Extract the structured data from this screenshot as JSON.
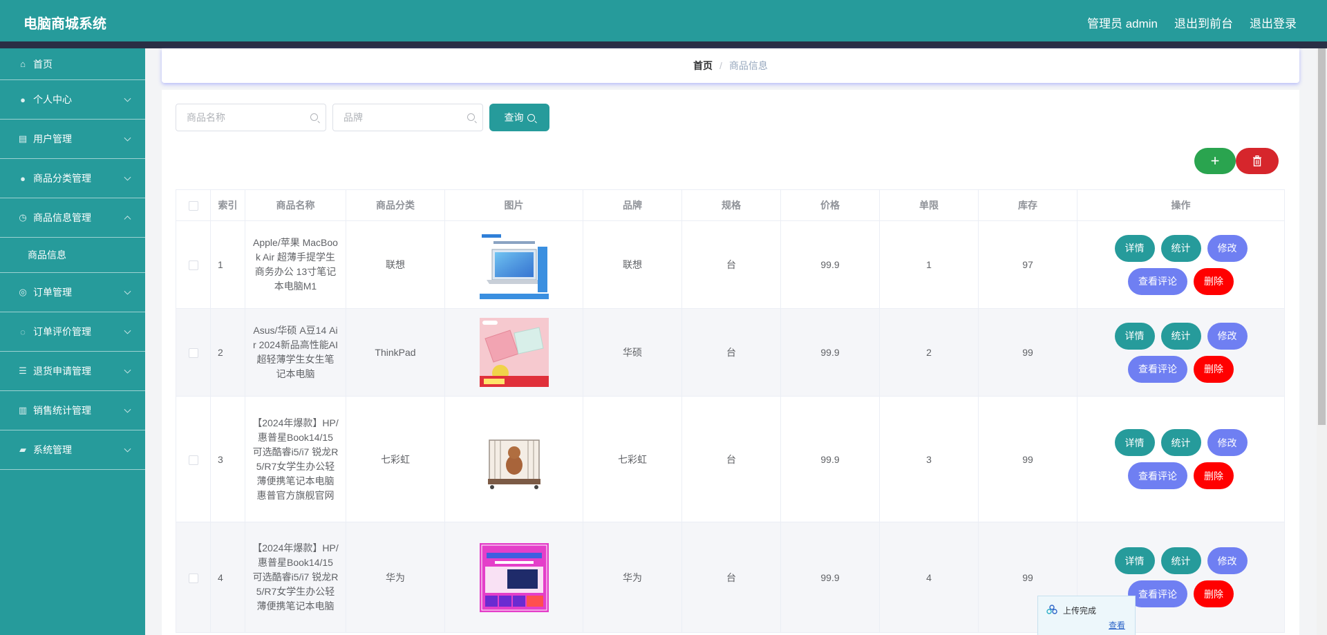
{
  "header": {
    "title": "电脑商城系统",
    "admin_label": "管理员 admin",
    "front_link": "退出到前台",
    "logout_link": "退出登录"
  },
  "sidebar": {
    "items": [
      {
        "label": "首页",
        "icon": "home-icon",
        "expandable": false
      },
      {
        "label": "个人中心",
        "icon": "user-icon",
        "expandable": true
      },
      {
        "label": "用户管理",
        "icon": "users-icon",
        "expandable": true
      },
      {
        "label": "商品分类管理",
        "icon": "user-icon",
        "expandable": true
      },
      {
        "label": "商品信息管理",
        "icon": "clock-icon",
        "expandable": true,
        "expanded": true,
        "children": [
          "商品信息"
        ]
      },
      {
        "label": "订单管理",
        "icon": "globe-icon",
        "expandable": true
      },
      {
        "label": "订单评价管理",
        "icon": "compass-icon",
        "expandable": true
      },
      {
        "label": "退货申请管理",
        "icon": "list-icon",
        "expandable": true
      },
      {
        "label": "销售统计管理",
        "icon": "bar-chart-icon",
        "expandable": true
      },
      {
        "label": "系统管理",
        "icon": "settings-icon",
        "expandable": true
      }
    ]
  },
  "breadcrumb": {
    "home": "首页",
    "separator": "/",
    "current": "商品信息"
  },
  "search": {
    "name_placeholder": "商品名称",
    "brand_placeholder": "品牌",
    "query_label": "查询"
  },
  "actions": {
    "add_symbol": "+",
    "add_color": "#2aa44f",
    "delete_color": "#d6262c"
  },
  "table": {
    "headers": [
      "索引",
      "商品名称",
      "商品分类",
      "图片",
      "品牌",
      "规格",
      "价格",
      "单限",
      "库存",
      "操作"
    ],
    "rows": [
      {
        "index": "1",
        "name": "Apple/苹果 MacBook Air 超薄手提学生商务办公 13寸笔记本电脑M1",
        "category": "联想",
        "image": "laptop-silver-thumbnail",
        "brand": "联想",
        "spec": "台",
        "price": "99.9",
        "limit": "1",
        "stock": "97"
      },
      {
        "index": "2",
        "name": "Asus/华硕 A豆14 Air 2024新品高性能AI超轻薄学生女生笔记本电脑",
        "category": "ThinkPad",
        "image": "laptop-pink-thumbnail",
        "brand": "华硕",
        "spec": "台",
        "price": "99.9",
        "limit": "2",
        "stock": "99"
      },
      {
        "index": "3",
        "name": "【2024年爆款】HP/惠普星Book14/15 可选酷睿i5/i7 锐龙R5/R7女学生办公轻薄便携笔记本电脑惠普官方旗舰官网",
        "category": "七彩虹",
        "image": "pet-cage-thumbnail",
        "brand": "七彩虹",
        "spec": "台",
        "price": "99.9",
        "limit": "3",
        "stock": "99"
      },
      {
        "index": "4",
        "name": "【2024年爆款】HP/惠普星Book14/15 可选酷睿i5/i7 锐龙R5/R7女学生办公轻薄便携笔记本电脑",
        "category": "华为",
        "image": "laptop-magenta-thumbnail",
        "brand": "华为",
        "spec": "台",
        "price": "99.9",
        "limit": "4",
        "stock": "99"
      }
    ],
    "row_buttons": {
      "detail": "详情",
      "stats": "统计",
      "edit": "修改",
      "reviews": "查看评论",
      "delete": "删除"
    }
  },
  "toast": {
    "message": "上传完成",
    "link": "查看"
  },
  "colors": {
    "primary": "#269b9b",
    "accent_blue": "#6f7ff2",
    "danger": "#ff0000"
  }
}
